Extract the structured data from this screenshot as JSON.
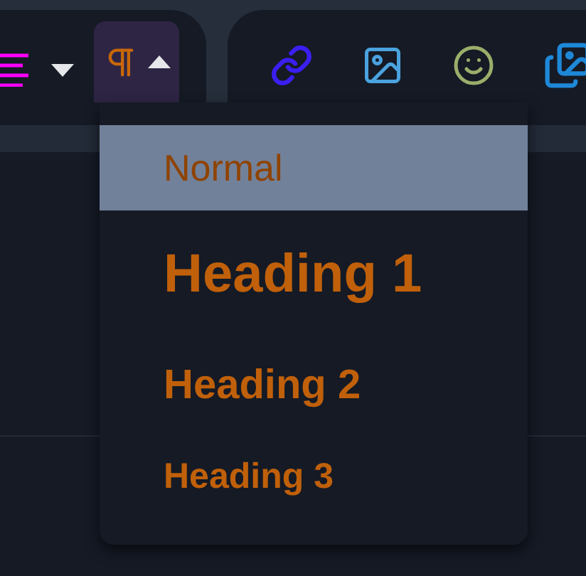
{
  "toolbar": {
    "align_menu": {
      "expanded": false
    },
    "paragraph_menu": {
      "expanded": true
    }
  },
  "paragraph_menu": {
    "items": [
      {
        "label": "Normal",
        "kind": "normal",
        "selected": true
      },
      {
        "label": "Heading 1",
        "kind": "h1",
        "selected": false
      },
      {
        "label": "Heading 2",
        "kind": "h2",
        "selected": false
      },
      {
        "label": "Heading 3",
        "kind": "h3",
        "selected": false
      }
    ]
  }
}
